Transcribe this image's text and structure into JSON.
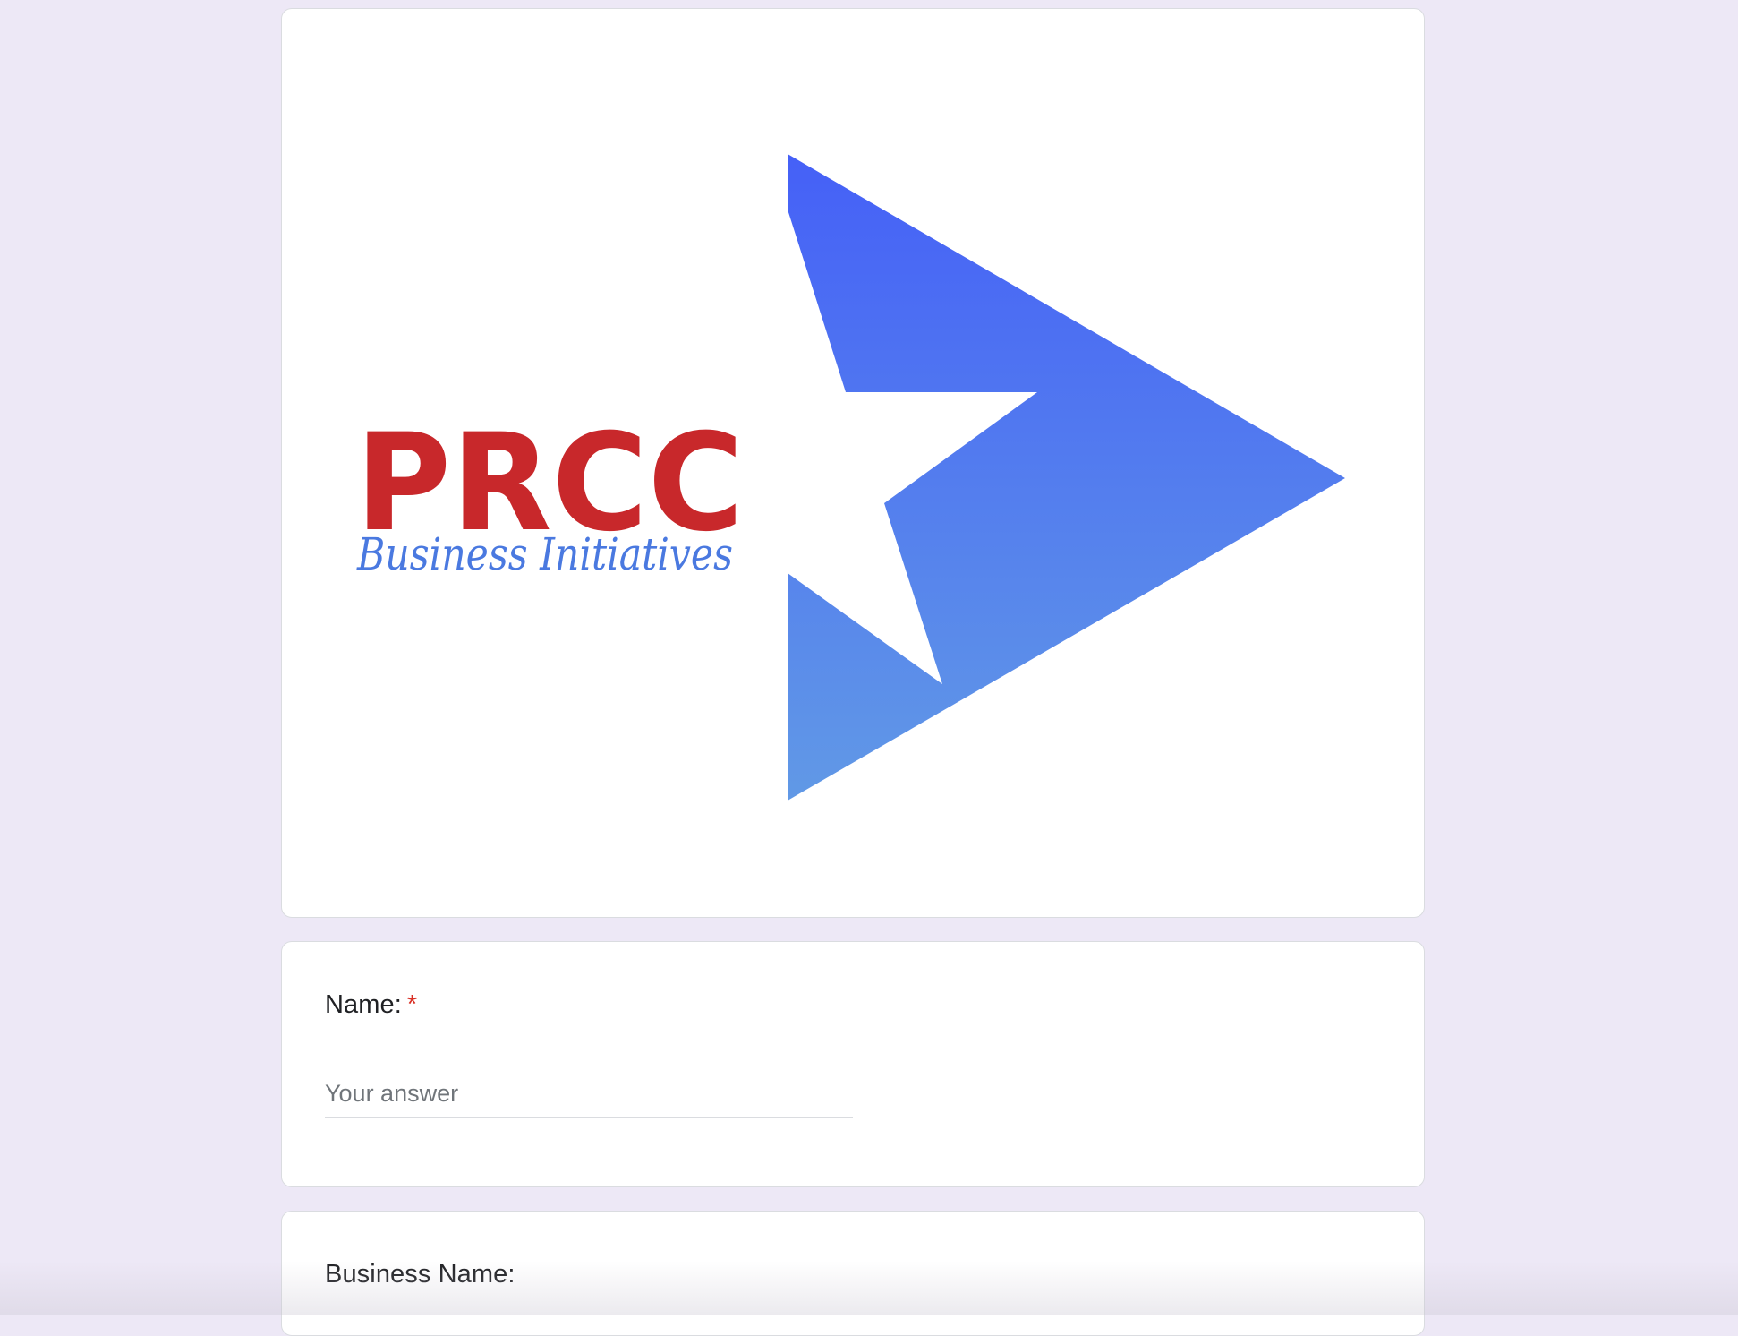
{
  "header": {
    "logo": {
      "wordmark": "PRCC",
      "tagline": "Business Initiatives"
    }
  },
  "questions": [
    {
      "title": "Name:",
      "required_marker": "*",
      "placeholder": "Your answer"
    },
    {
      "title": "Business Name:"
    }
  ],
  "colors": {
    "background": "#ede8f6",
    "wordmark": "#c8282b",
    "tagline": "#4a79e0",
    "star_gradient_top": "#4560f7",
    "star_gradient_bottom": "#6199e6",
    "required": "#d93025"
  }
}
